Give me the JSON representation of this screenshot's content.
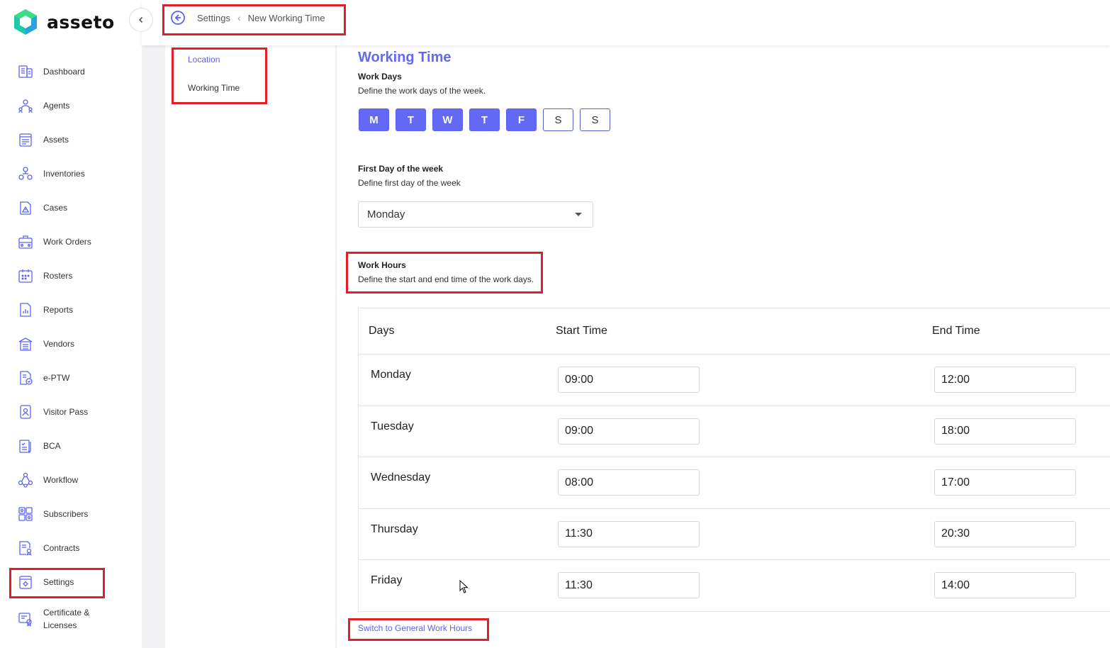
{
  "app": {
    "logo_text": "asseto"
  },
  "breadcrumb": {
    "parent": "Settings",
    "current": "New Working Time"
  },
  "sidebar": {
    "items": [
      {
        "label": "Dashboard",
        "icon": "dashboard-icon"
      },
      {
        "label": "Agents",
        "icon": "agents-icon"
      },
      {
        "label": "Assets",
        "icon": "assets-icon"
      },
      {
        "label": "Inventories",
        "icon": "inventories-icon"
      },
      {
        "label": "Cases",
        "icon": "cases-icon"
      },
      {
        "label": "Work Orders",
        "icon": "work-orders-icon"
      },
      {
        "label": "Rosters",
        "icon": "rosters-icon"
      },
      {
        "label": "Reports",
        "icon": "reports-icon"
      },
      {
        "label": "Vendors",
        "icon": "vendors-icon"
      },
      {
        "label": "e-PTW",
        "icon": "eptw-icon"
      },
      {
        "label": "Visitor Pass",
        "icon": "visitor-pass-icon"
      },
      {
        "label": "BCA",
        "icon": "bca-icon"
      },
      {
        "label": "Workflow",
        "icon": "workflow-icon"
      },
      {
        "label": "Subscribers",
        "icon": "subscribers-icon"
      },
      {
        "label": "Contracts",
        "icon": "contracts-icon"
      },
      {
        "label": "Settings",
        "icon": "settings-icon"
      },
      {
        "label_line1": "Certificate &",
        "label_line2": "Licenses",
        "icon": "certificate-icon"
      }
    ]
  },
  "subnav": {
    "items": [
      {
        "label": "Location"
      },
      {
        "label": "Working Time"
      }
    ]
  },
  "main": {
    "title": "Working Time",
    "work_days": {
      "title": "Work Days",
      "description": "Define the work days of the week.",
      "days": [
        {
          "label": "M",
          "selected": true
        },
        {
          "label": "T",
          "selected": true
        },
        {
          "label": "W",
          "selected": true
        },
        {
          "label": "T",
          "selected": true
        },
        {
          "label": "F",
          "selected": true
        },
        {
          "label": "S",
          "selected": false
        },
        {
          "label": "S",
          "selected": false
        }
      ]
    },
    "first_day": {
      "title": "First Day of the week",
      "description": "Define first day of the week",
      "value": "Monday"
    },
    "work_hours": {
      "title": "Work Hours",
      "description": "Define the start and end time of the work days.",
      "columns": [
        "Days",
        "Start Time",
        "End Time"
      ],
      "rows": [
        {
          "day": "Monday",
          "start": "09:00",
          "end": "12:00"
        },
        {
          "day": "Tuesday",
          "start": "09:00",
          "end": "18:00"
        },
        {
          "day": "Wednesday",
          "start": "08:00",
          "end": "17:00"
        },
        {
          "day": "Thursday",
          "start": "11:30",
          "end": "20:30"
        },
        {
          "day": "Friday",
          "start": "11:30",
          "end": "14:00"
        }
      ]
    },
    "switch_link": "Switch to General Work Hours"
  },
  "colors": {
    "accent": "#6368f5",
    "highlight": "#e11f2a"
  }
}
